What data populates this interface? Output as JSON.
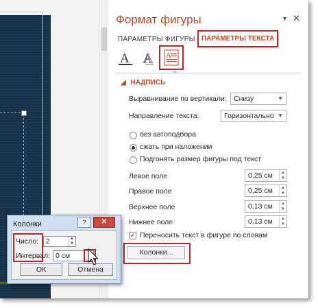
{
  "pane": {
    "title": "Формат фигуры",
    "pin_glyph": "▼",
    "close_glyph": "✕",
    "tabs": [
      {
        "label": "ПАРАМЕТРЫ ФИГУРЫ",
        "active": false
      },
      {
        "label": "ПАРАМЕТРЫ ТЕКСТА",
        "active": true
      }
    ],
    "icons": [
      "text-fill-outline-icon",
      "text-effects-icon",
      "textbox-icon"
    ],
    "section": {
      "caret": "◢",
      "title": "НАДПИСЬ"
    },
    "vertical_align": {
      "label": "Выравнивание по вертикали:",
      "value": "Снизу"
    },
    "text_direction": {
      "label": "Направление текста:",
      "value": "Горизонтально"
    },
    "autofit": [
      {
        "label": "без автоподбора",
        "selected": false
      },
      {
        "label": "сжать при наложении",
        "selected": true
      },
      {
        "label": "Подгонять размер фигуры под текст",
        "selected": false
      }
    ],
    "margins": [
      {
        "label": "Левое поле",
        "value": "0,25 см"
      },
      {
        "label": "Правое поле",
        "value": "0,25 см"
      },
      {
        "label": "Верхнее поле",
        "value": "0,13 см"
      },
      {
        "label": "Нижнее поле",
        "value": "0,13 см"
      }
    ],
    "wrap": {
      "label": "Переносить текст в фигуре по словам",
      "checked": true,
      "mark": "✓"
    },
    "columns_button": "Колонки..."
  },
  "dialog": {
    "title": "Колонки",
    "help": "?",
    "close": "✕",
    "number": {
      "label": "Число:",
      "value": "2"
    },
    "spacing": {
      "label": "Интервал:",
      "value": "0 см"
    },
    "ok": "ОК",
    "cancel": "Отмена"
  },
  "colors": {
    "accent": "#c2462a",
    "highlight": "#b22a2a",
    "slide_bg": "#163349",
    "slide_border": "#d6d85f"
  }
}
